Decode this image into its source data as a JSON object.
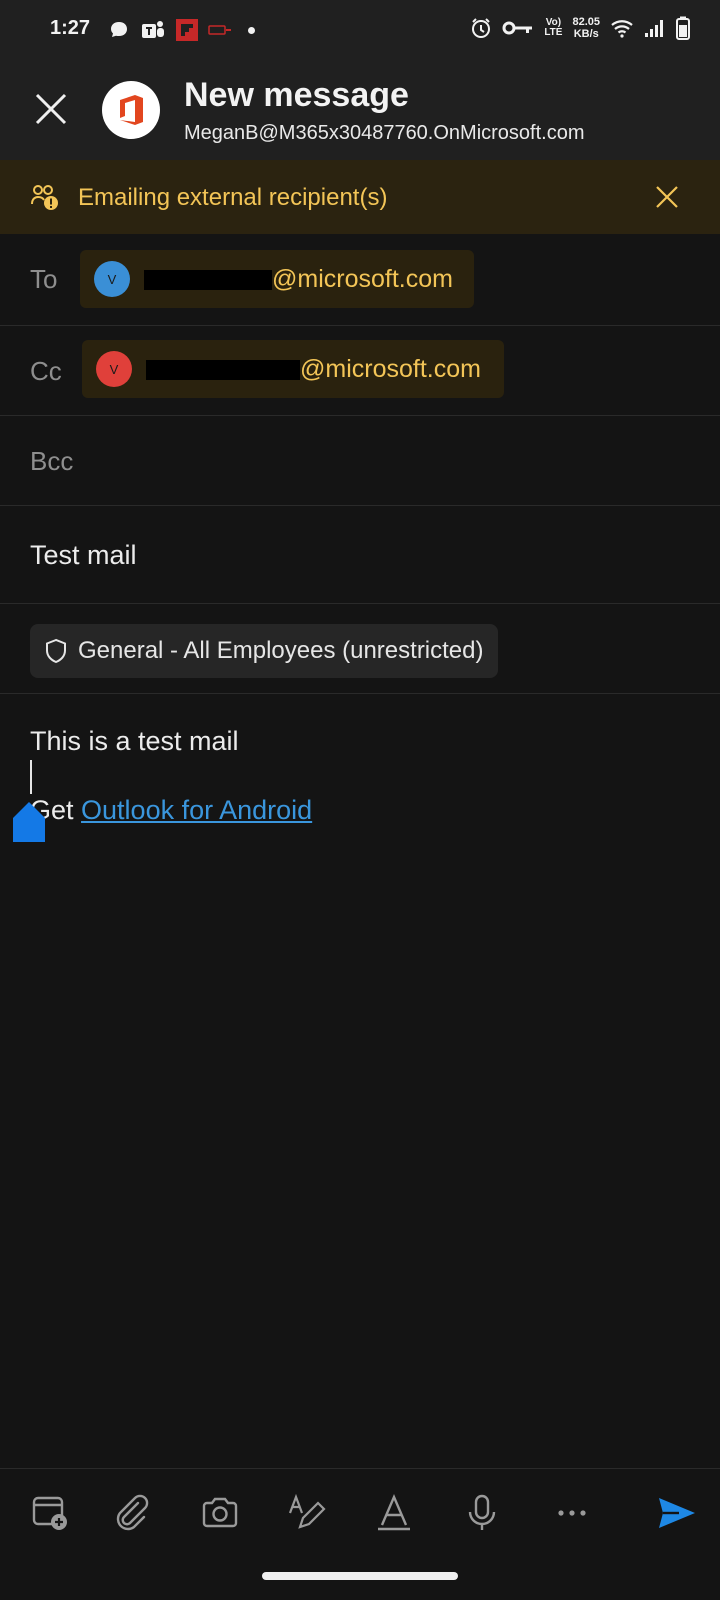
{
  "status_bar": {
    "time": "1:27",
    "network_speed_value": "82.05",
    "network_speed_unit": "KB/s",
    "volte_label": "Vo)",
    "lte_label": "LTE"
  },
  "header": {
    "title": "New message",
    "account": "MeganB@M365x30487760.OnMicrosoft.com"
  },
  "banner": {
    "text": "Emailing external recipient(s)"
  },
  "recipients": {
    "to_label": "To",
    "to_chip": {
      "initial": "V",
      "domain": "@microsoft.com",
      "avatar_color": "#3a8fd6"
    },
    "cc_label": "Cc",
    "cc_chip": {
      "initial": "V",
      "domain": "@microsoft.com",
      "avatar_color": "#e0403a"
    },
    "bcc_label": "Bcc"
  },
  "subject": "Test mail",
  "sensitivity_label": "General - All Employees (unrestricted)",
  "body": {
    "line1": "This is a test mail",
    "signature_prefix": "Get ",
    "signature_link": "Outlook for Android"
  },
  "toolbar": {
    "icons": [
      "calendar-add-icon",
      "attach-icon",
      "camera-icon",
      "format-text-icon",
      "font-style-icon",
      "microphone-icon",
      "more-icon",
      "send-icon"
    ]
  },
  "colors": {
    "accent": "#3a96dd",
    "warning": "#f3c557",
    "send": "#1e88e5"
  }
}
